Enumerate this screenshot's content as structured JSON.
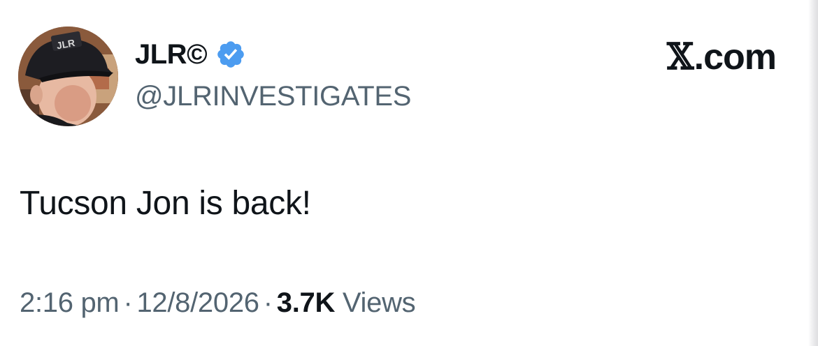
{
  "author": {
    "display_name": "JLR©",
    "handle": "@JLRINVESTIGATES",
    "verified": true,
    "verified_color": "#4c9cf0",
    "avatar_icon": "user-avatar-photo",
    "avatar_cap_text": "JLR"
  },
  "brand": {
    "logo_glyph": "𝕏",
    "logo_suffix": ".com"
  },
  "tweet": {
    "text": "Tucson Jon is back!"
  },
  "meta": {
    "time": "2:16 pm",
    "separator": "·",
    "date": "12/8/2026",
    "views_count": "3.7K",
    "views_label": "Views"
  },
  "colors": {
    "primary_text": "#0f1419",
    "secondary_text": "#536471",
    "background": "#ffffff"
  }
}
